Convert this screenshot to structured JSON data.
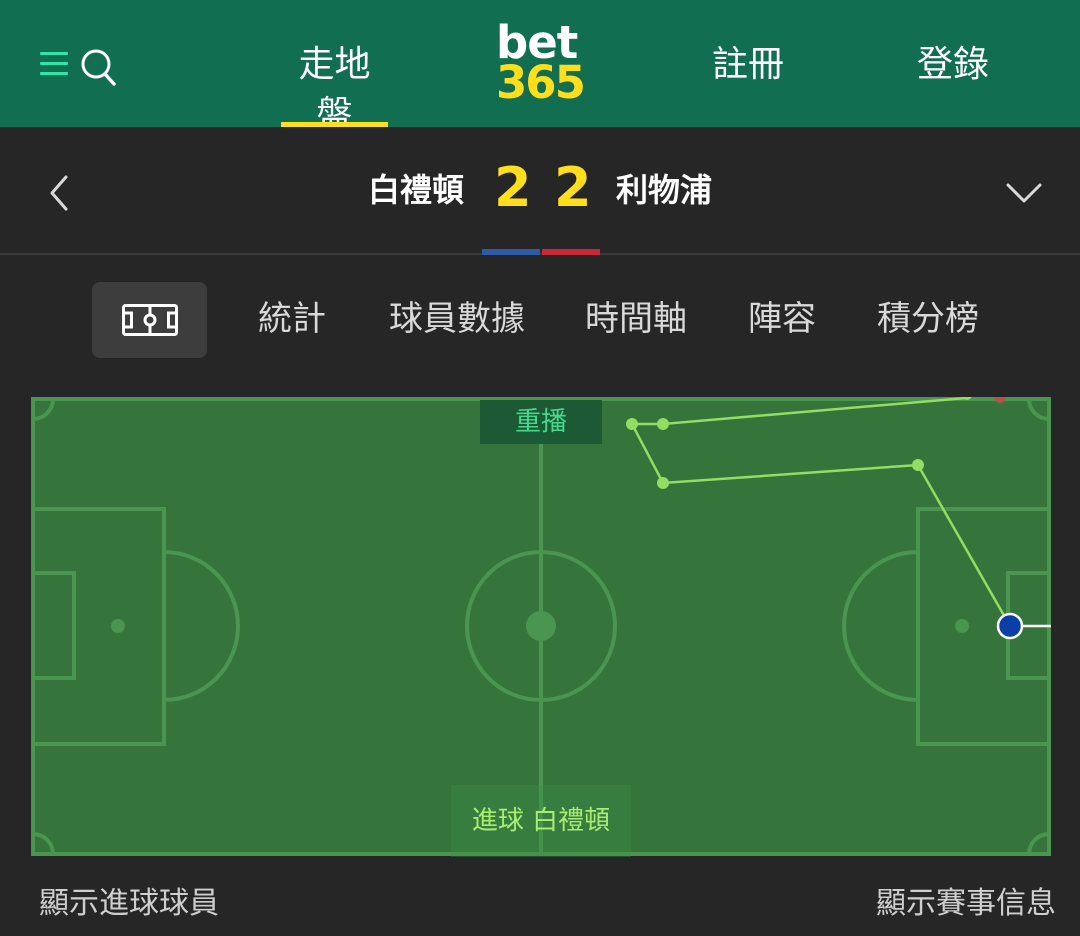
{
  "header": {
    "nav": {
      "in_play": "走地盤",
      "register": "註冊",
      "login": "登錄"
    },
    "logo": {
      "top": "bet",
      "bottom": "365"
    },
    "colors": {
      "brand_green": "#126e51",
      "accent_yellow": "#ffdf1b",
      "icon_green": "#2ee6a6"
    }
  },
  "match": {
    "home_team": "白禮頓",
    "home_score": "2",
    "away_score": "2",
    "away_team": "利物浦",
    "home_color": "#2e5aa8",
    "away_color": "#c8283a"
  },
  "tabs": {
    "stats": "統計",
    "player_stats": "球員數據",
    "timeline": "時間軸",
    "lineups": "陣容",
    "standings": "積分榜"
  },
  "pitch": {
    "replay_label": "重播",
    "event_label": "進球  白禮頓"
  },
  "footer": {
    "show_scorers": "顯示進球球員",
    "show_match_info": "顯示賽事信息"
  }
}
